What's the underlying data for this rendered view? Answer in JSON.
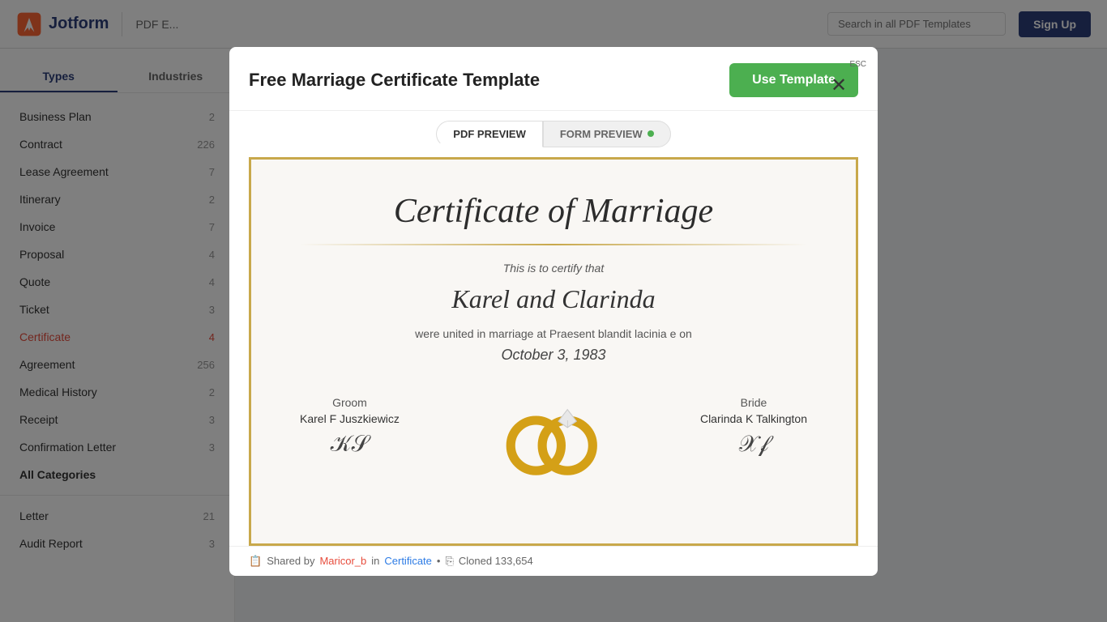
{
  "header": {
    "logo_text": "Jotform",
    "nav_text": "PDF E...",
    "search_placeholder": "Search in all PDF Templates",
    "signup_label": "Sign Up"
  },
  "sidebar": {
    "tab_types": "Types",
    "tab_industries": "Industries",
    "items": [
      {
        "label": "Business Plan",
        "count": "2"
      },
      {
        "label": "Contract",
        "count": "226"
      },
      {
        "label": "Lease Agreement",
        "count": "7"
      },
      {
        "label": "Itinerary",
        "count": "2"
      },
      {
        "label": "Invoice",
        "count": "7"
      },
      {
        "label": "Proposal",
        "count": "4"
      },
      {
        "label": "Quote",
        "count": "4"
      },
      {
        "label": "Ticket",
        "count": "3"
      },
      {
        "label": "Certificate",
        "count": "4",
        "active": true
      },
      {
        "label": "Agreement",
        "count": "256"
      },
      {
        "label": "Medical History",
        "count": "2"
      },
      {
        "label": "Receipt",
        "count": "3"
      },
      {
        "label": "Confirmation Letter",
        "count": "3"
      },
      {
        "label": "All Categories",
        "bold": true
      },
      {
        "label": "Letter",
        "count": "21"
      },
      {
        "label": "Audit Report",
        "count": "3"
      }
    ]
  },
  "modal": {
    "title": "Free Marriage Certificate Template",
    "use_template_label": "Use Template",
    "close_label": "ESC",
    "tab_pdf": "PDF PREVIEW",
    "tab_form": "FORM PREVIEW",
    "certificate": {
      "title": "Certificate of Marriage",
      "certify_text": "This is to certify that",
      "names": "Karel and Clarinda",
      "united_text": "were united in marriage at Praesent blandit lacinia e on",
      "date": "October 3, 1983",
      "groom_role": "Groom",
      "groom_name": "Karel F Juszkiewicz",
      "bride_role": "Bride",
      "bride_name": "Clarinda K Talkington"
    },
    "footer": {
      "shared_by": "Shared by",
      "author": "Maricor_b",
      "in_text": "in",
      "category": "Certificate",
      "cloned_text": "Cloned 133,654"
    }
  }
}
